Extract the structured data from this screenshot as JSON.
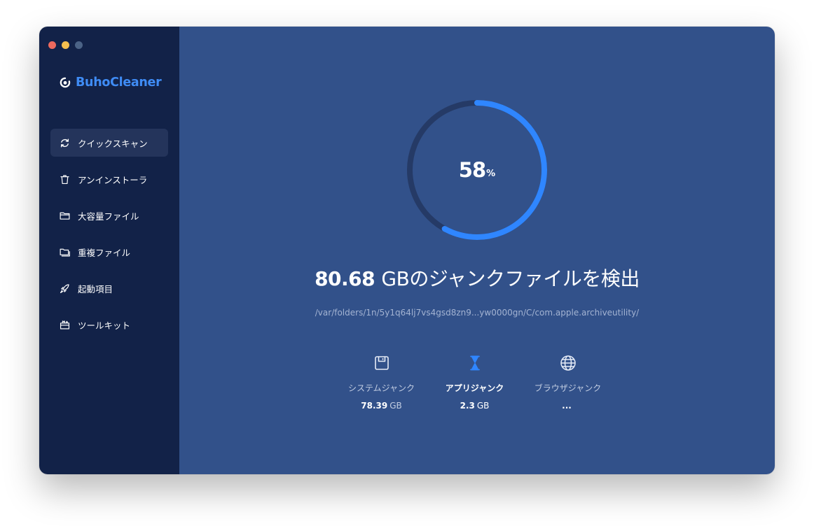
{
  "window": {
    "traffic_lights": {
      "close": "#ed6a5e",
      "minimize": "#f5bf4f",
      "zoom": "#4b6386"
    }
  },
  "brand": {
    "name": "BuhoCleaner",
    "icon": "buho-logo-icon",
    "color": "#3f8cf5"
  },
  "sidebar": {
    "items": [
      {
        "label": "クイックスキャン",
        "icon": "refresh-icon",
        "active": true
      },
      {
        "label": "アンインストーラ",
        "icon": "trash-icon",
        "active": false
      },
      {
        "label": "大容量ファイル",
        "icon": "folder-icon",
        "active": false
      },
      {
        "label": "重複ファイル",
        "icon": "duplicate-folder-icon",
        "active": false
      },
      {
        "label": "起動項目",
        "icon": "rocket-icon",
        "active": false
      },
      {
        "label": "ツールキット",
        "icon": "toolbox-icon",
        "active": false
      }
    ]
  },
  "scan": {
    "progress": 58,
    "percent_sign": "%",
    "total_size": "80.68",
    "total_unit": "GB",
    "result_text": "のジャンクファイルを検出",
    "current_path": "/var/folders/1n/5y1q64lj7vs4gsd8zn9...yw0000gn/C/com.apple.archiveutility/",
    "ring_color": "#2f86ff",
    "ring_track_color": "#253a66"
  },
  "categories": [
    {
      "label": "システムジャンク",
      "value": "78.39",
      "unit": "GB",
      "icon": "disk-icon",
      "active": false
    },
    {
      "label": "アプリジャンク",
      "value": "2.3",
      "unit": "GB",
      "icon": "hourglass-icon",
      "active": true
    },
    {
      "label": "ブラウザジャンク",
      "value": "...",
      "unit": "",
      "icon": "globe-icon",
      "active": false
    }
  ],
  "colors": {
    "sidebar_bg": "#122248",
    "main_bg": "#32518a",
    "active_item_bg": "#24345b"
  }
}
